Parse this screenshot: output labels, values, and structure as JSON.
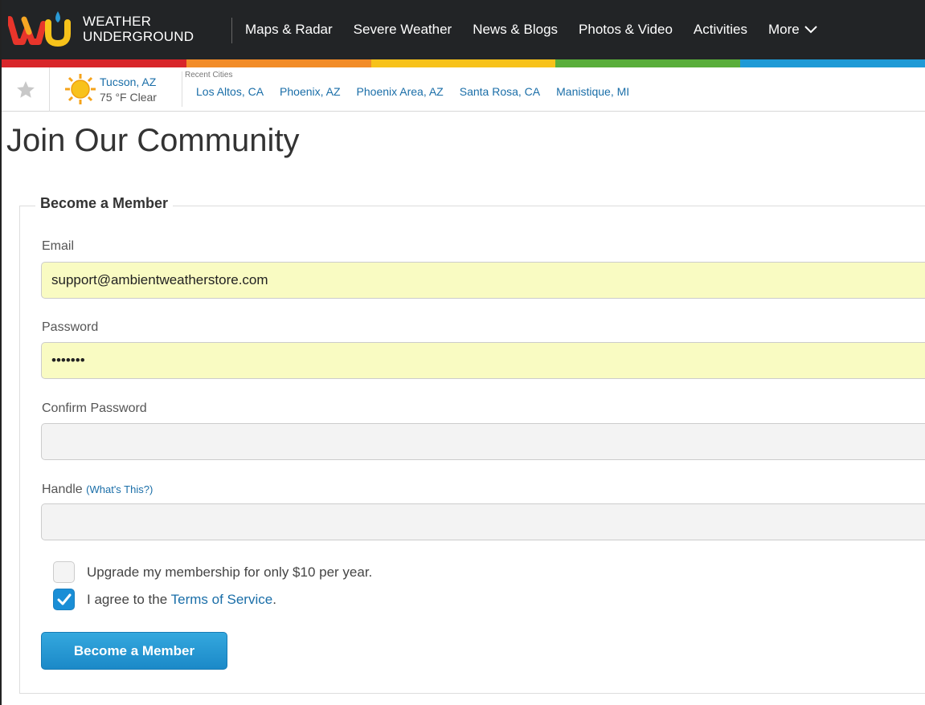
{
  "header": {
    "logo_line1": "WEATHER",
    "logo_line2": "UNDERGROUND",
    "nav": [
      "Maps & Radar",
      "Severe Weather",
      "News & Blogs",
      "Photos & Video",
      "Activities"
    ],
    "more_label": "More",
    "rainbow_colors": [
      "#d8262a",
      "#f28c28",
      "#f7c21a",
      "#5aae3b",
      "#1f9ad6"
    ]
  },
  "location": {
    "current_city": "Tucson, AZ",
    "current_conditions": "75 °F Clear",
    "recent_label": "Recent Cities",
    "recent_cities": [
      "Los Altos, CA",
      "Phoenix, AZ",
      "Phoenix Area, AZ",
      "Santa Rosa, CA",
      "Manistique, MI"
    ]
  },
  "page": {
    "title": "Join Our Community"
  },
  "form": {
    "legend": "Become a Member",
    "email_label": "Email",
    "email_value": "support@ambientweatherstore.com",
    "password_label": "Password",
    "password_value": "•••••••",
    "confirm_label": "Confirm Password",
    "confirm_value": "",
    "handle_label": "Handle",
    "handle_help": "(What's This?)",
    "handle_value": "",
    "upgrade_text": "Upgrade my membership for only $10 per year.",
    "upgrade_checked": false,
    "agree_text": "I agree to the",
    "agree_link": "Terms of Service",
    "agree_suffix": ".",
    "agree_checked": true,
    "submit_label": "Become a Member"
  },
  "colors": {
    "accent": "#1a8ed6",
    "link": "#1a6ea8",
    "autofill": "#f9fbc2",
    "nav_bg": "#222426"
  }
}
